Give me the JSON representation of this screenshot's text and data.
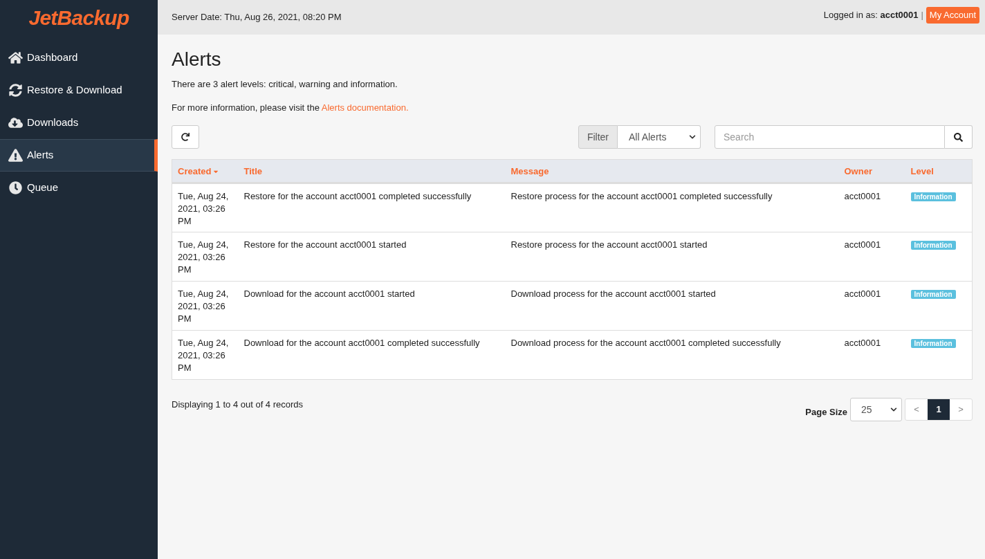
{
  "logo": "JetBackup",
  "sidebar": {
    "items": [
      {
        "label": "Dashboard",
        "selected": false
      },
      {
        "label": "Restore & Download",
        "selected": false
      },
      {
        "label": "Downloads",
        "selected": false
      },
      {
        "label": "Alerts",
        "selected": true
      },
      {
        "label": "Queue",
        "selected": false
      }
    ]
  },
  "header": {
    "server_date": "Server Date: Thu, Aug 26, 2021, 08:20 PM",
    "logged_in_label": "Logged in as:",
    "user": "acct0001",
    "separator": "|",
    "account_button": "My Account"
  },
  "page": {
    "title": "Alerts",
    "intro": "There are 3 alert levels: critical, warning and information.",
    "more_info": "For more information, please visit the",
    "doc_link": "Alerts documentation."
  },
  "toolbar": {
    "filter_label": "Filter",
    "filter_value": "All Alerts",
    "search_placeholder": "Search"
  },
  "table": {
    "columns": [
      {
        "label": "Created",
        "sorted": true
      },
      {
        "label": "Title",
        "sorted": false
      },
      {
        "label": "Message",
        "sorted": false
      },
      {
        "label": "Owner",
        "sorted": false
      },
      {
        "label": "Level",
        "sorted": false
      }
    ],
    "rows": [
      {
        "created": "Tue, Aug 24, 2021, 03:26 PM",
        "title": "Restore for the account acct0001 completed successfully",
        "message": "Restore process for the account acct0001 completed successfully",
        "owner": "acct0001",
        "level": "Information",
        "kind": "information"
      },
      {
        "created": "Tue, Aug 24, 2021, 03:26 PM",
        "title": "Restore for the account acct0001 started",
        "message": "Restore process for the account acct0001 started",
        "owner": "acct0001",
        "level": "Information",
        "kind": "information"
      },
      {
        "created": "Tue, Aug 24, 2021, 03:26 PM",
        "title": "Download for the account acct0001 started",
        "message": "Download process for the account acct0001 started",
        "owner": "acct0001",
        "level": "Information",
        "kind": "information"
      },
      {
        "created": "Tue, Aug 24, 2021, 03:26 PM",
        "title": "Download for the account acct0001 completed successfully",
        "message": "Download process for the account acct0001 completed successfully",
        "owner": "acct0001",
        "level": "Information",
        "kind": "information"
      }
    ]
  },
  "footer": {
    "records": "Displaying 1 to 4 out of 4 records",
    "page_size_label": "Page Size",
    "page_size": "25",
    "prev": "<",
    "next": ">",
    "pages": [
      {
        "label": "1",
        "selected": true
      }
    ]
  }
}
